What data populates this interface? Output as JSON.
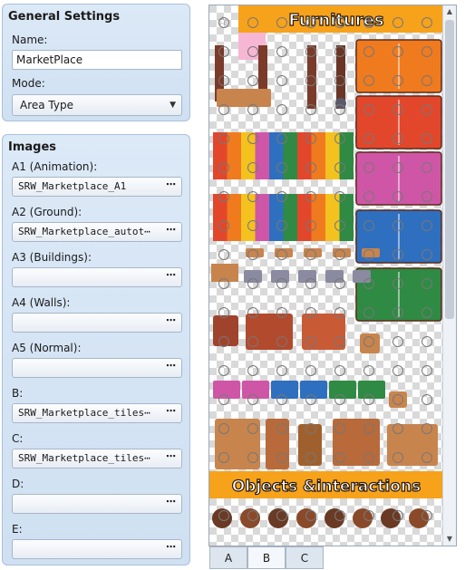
{
  "general": {
    "title": "General Settings",
    "name_label": "Name:",
    "name_value": "MarketPlace",
    "mode_label": "Mode:",
    "mode_value": "Area Type"
  },
  "images": {
    "title": "Images",
    "slots": [
      {
        "label": "A1 (Animation):",
        "value": "SRW_Marketplace_A1"
      },
      {
        "label": "A2 (Ground):",
        "value": "SRW_Marketplace_autot⋯"
      },
      {
        "label": "A3 (Buildings):",
        "value": ""
      },
      {
        "label": "A4 (Walls):",
        "value": ""
      },
      {
        "label": "A5 (Normal):",
        "value": ""
      },
      {
        "label": "B:",
        "value": "SRW_Marketplace_tiles⋯"
      },
      {
        "label": "C:",
        "value": "SRW_Marketplace_tiles⋯"
      },
      {
        "label": "D:",
        "value": ""
      },
      {
        "label": "E:",
        "value": ""
      }
    ],
    "browse_label": "⋯"
  },
  "tileset": {
    "banner_top": "Furnitures",
    "banner_bottom": "Objects &interactions",
    "star": "☆"
  },
  "tabs": [
    "A",
    "B",
    "C"
  ],
  "active_tab": "B",
  "scroll": {
    "up": "▲",
    "down": "▼"
  },
  "colors": {
    "banner": "#f7a21b",
    "banner_text": "#2a1a0a",
    "panel_bg": "#d5e4f5",
    "wood": "#c8844d",
    "orange": "#f07a1e",
    "red": "#e2472c",
    "pink": "#cf56a6",
    "blue": "#2f6fbf",
    "green": "#2f8a44"
  }
}
